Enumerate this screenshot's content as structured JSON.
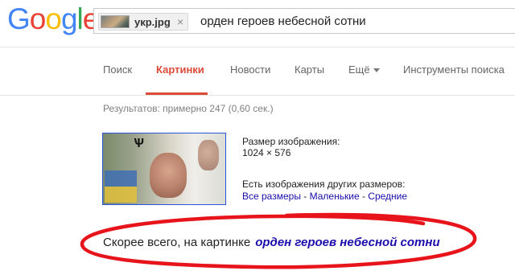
{
  "logo": {
    "letters": [
      "G",
      "o",
      "o",
      "g",
      "l",
      "e"
    ],
    "colors": [
      "#4285f4",
      "#ea4335",
      "#fbbc05",
      "#4285f4",
      "#34a853",
      "#ea4335"
    ]
  },
  "search": {
    "image_chip": {
      "filename": "укр.jpg",
      "close_glyph": "×"
    },
    "query": "орден героев небесной сотни"
  },
  "tabs": [
    {
      "label": "Поиск",
      "active": false
    },
    {
      "label": "Картинки",
      "active": true
    },
    {
      "label": "Новости",
      "active": false
    },
    {
      "label": "Карты",
      "active": false
    },
    {
      "label": "Ещё",
      "active": false,
      "dropdown": true
    },
    {
      "label": "Инструменты поиска",
      "active": false
    }
  ],
  "results": {
    "stats": "Результатов: примерно 247 (0,60 сек.)",
    "image_info": {
      "size_label": "Размер изображения:",
      "size_value": "1024 × 576",
      "other_sizes_label": "Есть изображения других размеров:",
      "links": [
        "Все размеры",
        "Маленькие",
        "Средние"
      ],
      "link_separator": " - "
    },
    "best_guess": {
      "prefix": "Скорее всего, на картинке",
      "link": "орден героев небесной сотни"
    }
  },
  "colors": {
    "active_tab": "#dd4b39",
    "link": "#1a0dab",
    "annotation_circle": "#e8141c"
  }
}
